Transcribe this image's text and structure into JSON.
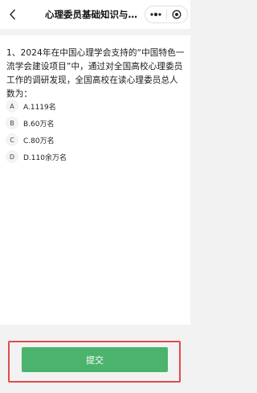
{
  "nav": {
    "title": "心理委员基础知识与实…"
  },
  "question": {
    "text": "1、2024年在中国心理学会支持的“中国特色一流学会建设项目”中，通过对全国高校心理委员工作的调研发现，全国高校在读心理委员总人数为："
  },
  "options": [
    {
      "letter": "A",
      "text": "A.1119名"
    },
    {
      "letter": "B",
      "text": "B.60万名"
    },
    {
      "letter": "C",
      "text": "C.80万名"
    },
    {
      "letter": "D",
      "text": "D.110余万名"
    }
  ],
  "footer": {
    "submit_label": "提交"
  },
  "colors": {
    "accent": "#4bb36c",
    "highlight": "#e24a4a"
  }
}
